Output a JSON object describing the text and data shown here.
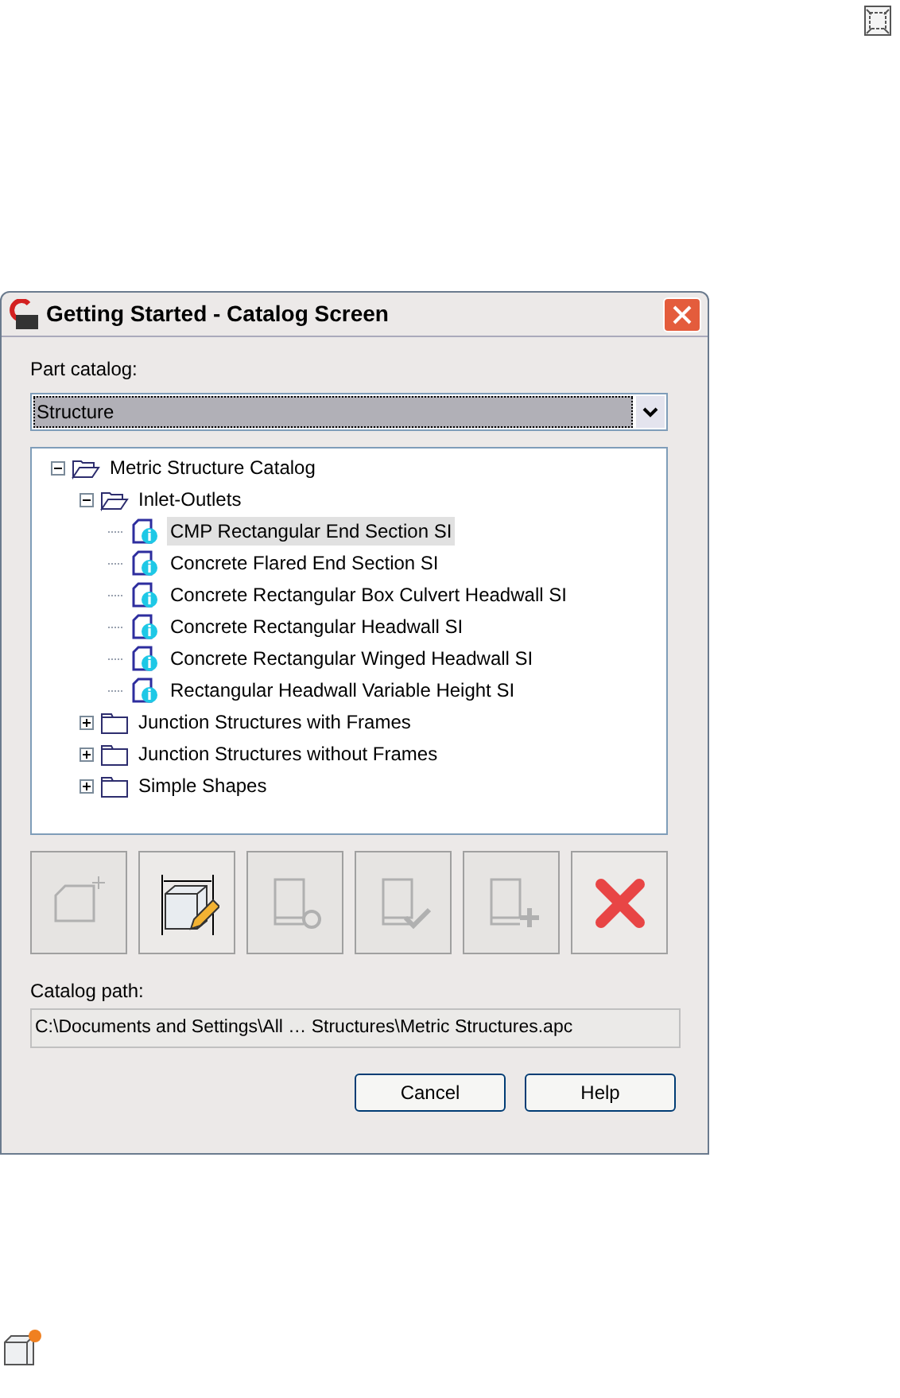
{
  "window": {
    "title": "Getting Started - Catalog Screen"
  },
  "part_catalog": {
    "label": "Part catalog:",
    "value": "Structure"
  },
  "tree": [
    {
      "kind": "folder",
      "label": "Metric Structure Catalog",
      "expanded": true,
      "selected": false,
      "children": [
        {
          "kind": "folder",
          "label": "Inlet-Outlets",
          "expanded": true,
          "selected": false,
          "children": [
            {
              "kind": "part",
              "label": "CMP Rectangular End Section SI",
              "selected": true
            },
            {
              "kind": "part",
              "label": "Concrete Flared End Section SI",
              "selected": false
            },
            {
              "kind": "part",
              "label": "Concrete Rectangular Box Culvert Headwall SI",
              "selected": false
            },
            {
              "kind": "part",
              "label": "Concrete Rectangular Headwall SI",
              "selected": false
            },
            {
              "kind": "part",
              "label": "Concrete Rectangular Winged Headwall SI",
              "selected": false
            },
            {
              "kind": "part",
              "label": "Rectangular Headwall Variable Height SI",
              "selected": false
            }
          ]
        },
        {
          "kind": "folder",
          "label": "Junction Structures with Frames",
          "expanded": false,
          "selected": false
        },
        {
          "kind": "folder",
          "label": "Junction Structures without Frames",
          "expanded": false,
          "selected": false
        },
        {
          "kind": "folder",
          "label": "Simple Shapes",
          "expanded": false,
          "selected": false
        }
      ]
    }
  ],
  "tools": [
    {
      "kind": "new",
      "disabled": true
    },
    {
      "kind": "edit",
      "disabled": false
    },
    {
      "kind": "refresh",
      "disabled": true
    },
    {
      "kind": "check",
      "disabled": true
    },
    {
      "kind": "add",
      "disabled": true
    },
    {
      "kind": "delete",
      "disabled": false
    }
  ],
  "catalog_path": {
    "label": "Catalog path:",
    "value": "C:\\Documents and Settings\\All … Structures\\Metric Structures.apc"
  },
  "buttons": [
    "Cancel",
    "Help"
  ]
}
